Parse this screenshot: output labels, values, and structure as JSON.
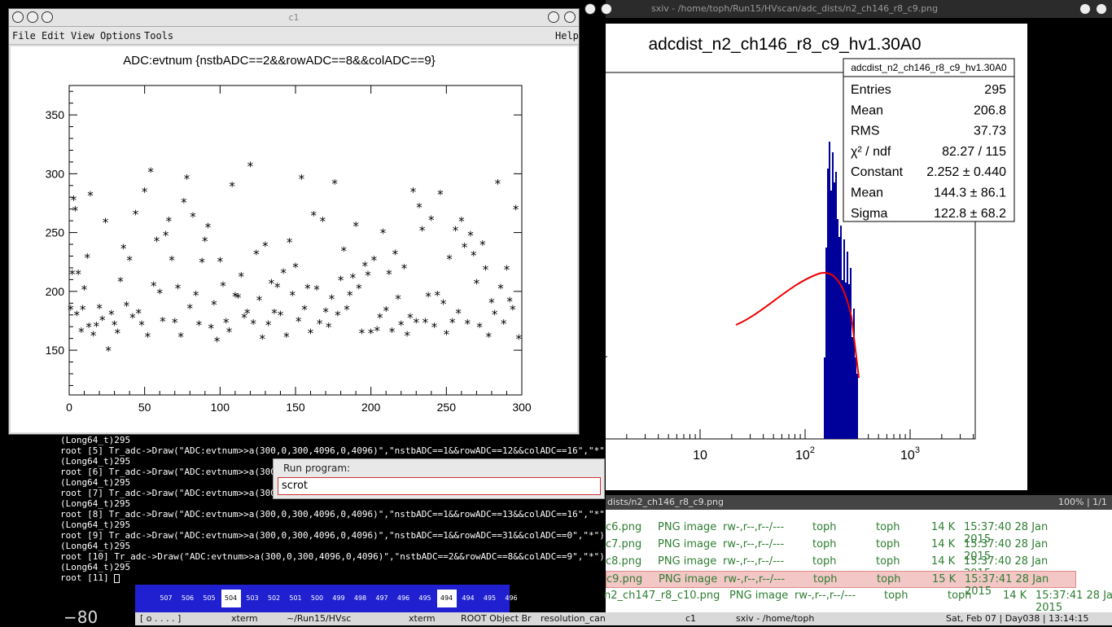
{
  "canvas_window": {
    "title": "c1",
    "menu": [
      "File",
      "Edit",
      "View",
      "Options",
      "Tools"
    ],
    "help": "Help"
  },
  "chart_data": [
    {
      "type": "scatter",
      "title": "ADC:evtnum {nstbADC==2&&rowADC==8&&colADC==9}",
      "xlim": [
        0,
        300
      ],
      "ylim": [
        112,
        375
      ],
      "xticks": [
        "0",
        "50",
        "100",
        "150",
        "200",
        "250",
        "300"
      ],
      "yticks": [
        "150",
        "200",
        "250",
        "300",
        "350"
      ],
      "marker": "*",
      "x": [
        1,
        2,
        3,
        4,
        5,
        6,
        8,
        9,
        10,
        12,
        13,
        14,
        16,
        18,
        20,
        22,
        24,
        26,
        28,
        30,
        32,
        34,
        36,
        38,
        40,
        42,
        44,
        46,
        48,
        50,
        52,
        54,
        56,
        58,
        60,
        62,
        64,
        66,
        68,
        70,
        72,
        74,
        76,
        78,
        80,
        82,
        84,
        86,
        88,
        90,
        92,
        94,
        96,
        98,
        100,
        102,
        104,
        106,
        108,
        110,
        112,
        114,
        116,
        118,
        120,
        122,
        124,
        126,
        128,
        130,
        132,
        134,
        136,
        138,
        140,
        142,
        144,
        146,
        148,
        150,
        152,
        154,
        156,
        158,
        160,
        162,
        164,
        166,
        168,
        170,
        172,
        174,
        176,
        178,
        180,
        182,
        184,
        186,
        188,
        190,
        192,
        194,
        196,
        198,
        200,
        202,
        204,
        206,
        208,
        210,
        212,
        214,
        216,
        218,
        220,
        222,
        224,
        226,
        228,
        230,
        232,
        234,
        236,
        238,
        240,
        242,
        244,
        246,
        248,
        250,
        252,
        254,
        256,
        258,
        260,
        262,
        264,
        266,
        268,
        270,
        272,
        274,
        276,
        278,
        280,
        282,
        284,
        286,
        288,
        290,
        292,
        294,
        296,
        298
      ],
      "y": [
        185,
        215,
        278,
        269,
        180,
        215,
        166,
        185,
        202,
        229,
        170,
        282,
        163,
        171,
        186,
        176,
        259,
        150,
        181,
        172,
        165,
        209,
        237,
        188,
        227,
        178,
        266,
        182,
        172,
        285,
        162,
        302,
        205,
        243,
        199,
        175,
        248,
        260,
        227,
        174,
        203,
        162,
        276,
        296,
        186,
        264,
        197,
        172,
        225,
        243,
        255,
        169,
        189,
        158,
        226,
        205,
        174,
        166,
        290,
        196,
        195,
        213,
        178,
        182,
        307,
        173,
        232,
        193,
        160,
        239,
        172,
        207,
        182,
        204,
        180,
        216,
        162,
        242,
        197,
        221,
        175,
        296,
        185,
        203,
        165,
        265,
        202,
        173,
        260,
        183,
        170,
        194,
        292,
        180,
        210,
        235,
        185,
        197,
        212,
        256,
        203,
        165,
        222,
        214,
        165,
        227,
        167,
        178,
        250,
        184,
        215,
        166,
        232,
        194,
        172,
        220,
        163,
        178,
        285,
        174,
        272,
        252,
        174,
        196,
        261,
        170,
        197,
        283,
        190,
        164,
        228,
        174,
        252,
        182,
        260,
        238,
        173,
        248,
        231,
        207,
        170,
        240,
        219,
        162,
        191,
        181,
        292,
        203,
        173,
        219,
        192,
        185,
        270,
        160
      ]
    },
    {
      "type": "bar",
      "title": "adcdist_n2_ch146_r8_c9_hv1.30A0",
      "xscale": "log",
      "xticks": [
        "10",
        "10^2",
        "10^3"
      ],
      "stats": {
        "name": "adcdist_n2_ch146_r8_c9_hv1.30A0",
        "rows": [
          {
            "label": "Entries",
            "value": "295"
          },
          {
            "label": "Mean",
            "value": "206.8"
          },
          {
            "label": "RMS",
            "value": "37.73"
          },
          {
            "label": "χ² / ndf",
            "value": "82.27 / 115"
          },
          {
            "label": "Constant",
            "value": "2.252 ± 0.440"
          },
          {
            "label": "Mean",
            "value": "144.3 ± 86.1"
          },
          {
            "label": "Sigma",
            "value": "122.8 ± 68.2"
          }
        ]
      }
    }
  ],
  "terminal": {
    "lines": [
      "(Long64_t)295",
      "root [5] Tr_adc->Draw(\"ADC:evtnum>>a(300,0,300,4096,0,4096)\",\"nstbADC==1&&rowADC==12&&colADC==16\",\"*\")",
      "(Long64_t)295",
      "root [6] Tr_adc->Draw(\"ADC:evtnum>>a(300,0,",
      "(Long64_t)295",
      "root [7] Tr_adc->Draw(\"ADC:evtnum>>a(300,0,",
      "(Long64_t)295",
      "root [8] Tr_adc->Draw(\"ADC:evtnum>>a(300,0,300,4096,0,4096)\",\"nstbADC==1&&rowADC==13&&colADC==16\",\"*\")",
      "(Long64_t)295",
      "root [9] Tr_adc->Draw(\"ADC:evtnum>>a(300,0,300,4096,0,4096)\",\"nstbADC==1&&rowADC==31&&colADC==0\",\"*\")",
      "(Long64_t)295",
      "root [10] Tr_adc->Draw(\"ADC:evtnum>>a(300,0,300,4096,0,4096)\",\"nstbADC==2&&rowADC==8&&colADC==9\",\"*\")",
      "(Long64_t)295",
      "root [11] "
    ]
  },
  "run_dialog": {
    "label": "Run program:",
    "value": "scrot"
  },
  "sxiv": {
    "title": "sxiv - /home/toph/Run15/HVscan/adc_dists/n2_ch146_r8_c9.png",
    "status_path": "dists/n2_ch146_r8_c9.png",
    "status_right": "100% | 1/1"
  },
  "file_manager": {
    "rows": [
      {
        "name": "c6.png",
        "type": "PNG image",
        "perm": "rw-,r--,r--/---",
        "user": "toph",
        "group": "toph",
        "size": "14 K",
        "time": "15:37:40 28 Jan 2015"
      },
      {
        "name": "c7.png",
        "type": "PNG image",
        "perm": "rw-,r--,r--/---",
        "user": "toph",
        "group": "toph",
        "size": "14 K",
        "time": "15:37:40 28 Jan 2015"
      },
      {
        "name": "c8.png",
        "type": "PNG image",
        "perm": "rw-,r--,r--/---",
        "user": "toph",
        "group": "toph",
        "size": "14 K",
        "time": "15:37:40 28 Jan 2015"
      },
      {
        "name": "c9.png",
        "type": "PNG image",
        "perm": "rw-,r--,r--/---",
        "user": "toph",
        "group": "toph",
        "size": "15 K",
        "time": "15:37:41 28 Jan 2015"
      },
      {
        "name": "n2_ch147_r8_c10.png",
        "type": "PNG image",
        "perm": "rw-,r--,r--/---",
        "user": "toph",
        "group": "toph",
        "size": "14 K",
        "time": "15:37:41 28 Jan 2015"
      }
    ]
  },
  "bg_cells": [
    "507",
    "506",
    "505",
    "504",
    "503",
    "502",
    "501",
    "500",
    "499",
    "498",
    "497",
    "496",
    "495",
    "494",
    "494",
    "495",
    "496"
  ],
  "bg_axis_label": "−80",
  "taskbar": {
    "items": [
      "[ o . . . . ]",
      "xterm",
      "~/Run15/HVsc",
      "xterm",
      "ROOT Object Br",
      "resolution_can",
      "c1",
      "sxiv - /home/toph"
    ],
    "clock": "Sat, Feb 07  |  Day038  |  13:14:15"
  }
}
